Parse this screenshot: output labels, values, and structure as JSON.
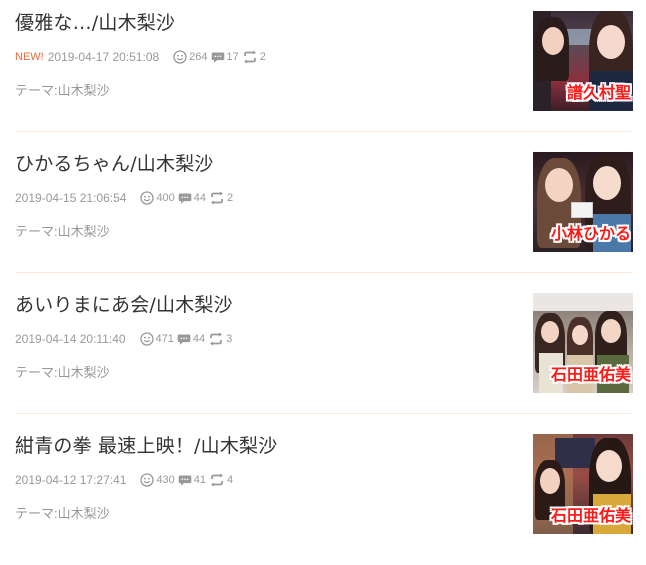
{
  "entries": [
    {
      "title": "優雅な…/山木梨沙",
      "new_label": "NEW!",
      "datetime": "2019-04-17 20:51:08",
      "likes": "264",
      "comments": "17",
      "reblogs": "2",
      "theme": "テーマ:山木梨沙",
      "thumb_caption": "譜久村聖"
    },
    {
      "title": "ひかるちゃん/山木梨沙",
      "datetime": "2019-04-15 21:06:54",
      "likes": "400",
      "comments": "44",
      "reblogs": "2",
      "theme": "テーマ:山木梨沙",
      "thumb_caption": "小林ひかる"
    },
    {
      "title": "あいりまにあ会/山木梨沙",
      "datetime": "2019-04-14 20:11:40",
      "likes": "471",
      "comments": "44",
      "reblogs": "3",
      "theme": "テーマ:山木梨沙",
      "thumb_caption": "石田亜佑美"
    },
    {
      "title": "紺青の拳 最速上映！/山木梨沙",
      "datetime": "2019-04-12 17:27:41",
      "likes": "430",
      "comments": "41",
      "reblogs": "4",
      "theme": "テーマ:山木梨沙",
      "thumb_caption": "石田亜佑美"
    }
  ],
  "colors": {
    "new_badge": "#e8683a",
    "caption": "#ff1a1a",
    "divider": "#fbe9dc",
    "meta_text": "#999999"
  },
  "icons": {
    "likes": "smiley-icon",
    "comments": "speech-bubble-icon",
    "reblogs": "reblog-icon"
  }
}
